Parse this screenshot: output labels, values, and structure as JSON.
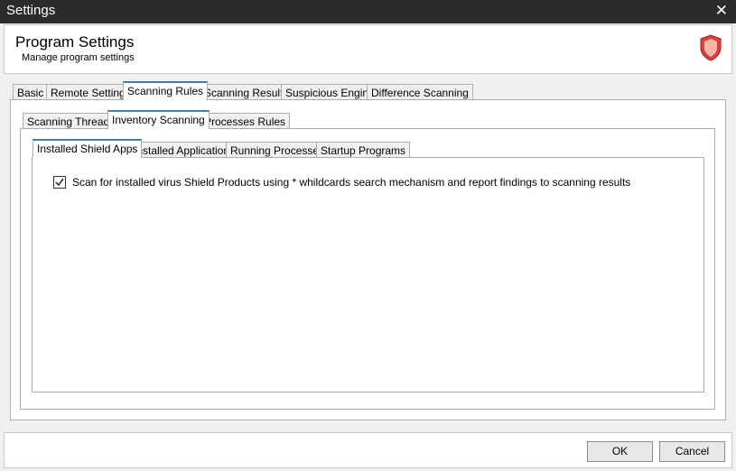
{
  "window": {
    "title": "Settings",
    "close_icon": "close-icon"
  },
  "header": {
    "title": "Program Settings",
    "subtitle": "Manage program settings",
    "icon": "shield-icon",
    "icon_color": "#d94040"
  },
  "tabs_level1": [
    {
      "label": "Basic",
      "active": false
    },
    {
      "label": "Remote Settings",
      "active": false
    },
    {
      "label": "Scanning Rules",
      "active": true
    },
    {
      "label": "Scanning Results",
      "active": false
    },
    {
      "label": "Suspicious Engine",
      "active": false
    },
    {
      "label": "Difference Scanning",
      "active": false
    }
  ],
  "tabs_level2": [
    {
      "label": "Scanning Threads",
      "active": false
    },
    {
      "label": "Inventory Scanning",
      "active": true
    },
    {
      "label": "Processes Rules",
      "active": false
    }
  ],
  "tabs_level3": [
    {
      "label": "Installed Shield Apps",
      "active": true
    },
    {
      "label": "Installed Applications",
      "active": false
    },
    {
      "label": "Running Processes",
      "active": false
    },
    {
      "label": "Startup Programs",
      "active": false
    }
  ],
  "options": {
    "scan_installed_label": "Scan for installed virus Shield Products using * whildcards search mechanism and report findings to scanning results",
    "scan_installed_checked": true
  },
  "footer": {
    "ok_label": "OK",
    "cancel_label": "Cancel"
  },
  "colors": {
    "active_tab_accent": "#3c7fb1",
    "titlebar": "#2b2b2b"
  }
}
